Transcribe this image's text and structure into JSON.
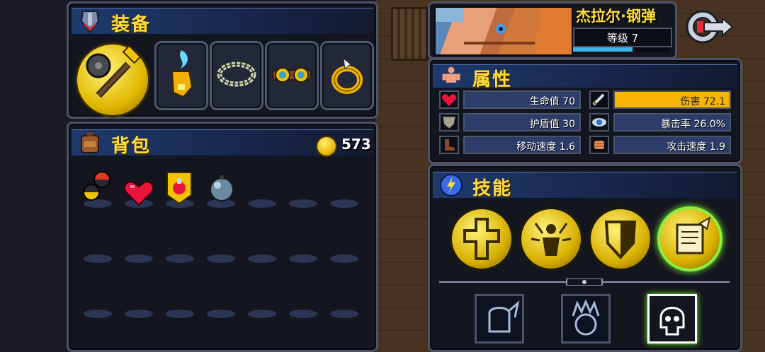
{
  "equipment": {
    "title": "装备"
  },
  "bag": {
    "title": "背包",
    "gold": "573"
  },
  "hero": {
    "name": "杰拉尔·钢弹",
    "level_text": "等级 7",
    "xp_fraction": 0.62
  },
  "attributes": {
    "title": "属性",
    "stats": [
      {
        "label": "生命值 70",
        "icon": "heart-icon"
      },
      {
        "label": "伤害 72.1",
        "icon": "sword-icon",
        "highlight": true
      },
      {
        "label": "护盾值 30",
        "icon": "shield-icon"
      },
      {
        "label": "暴击率 26.0%",
        "icon": "eye-icon"
      },
      {
        "label": "移动速度 1.6",
        "icon": "boot-icon"
      },
      {
        "label": "攻击速度 1.9",
        "icon": "fist-icon"
      }
    ]
  },
  "skills": {
    "title": "技能"
  },
  "colors": {
    "accent": "#ffdc3c",
    "panel": "#14161f",
    "header": "#1e3a6e",
    "highlight": "#f4b400"
  }
}
